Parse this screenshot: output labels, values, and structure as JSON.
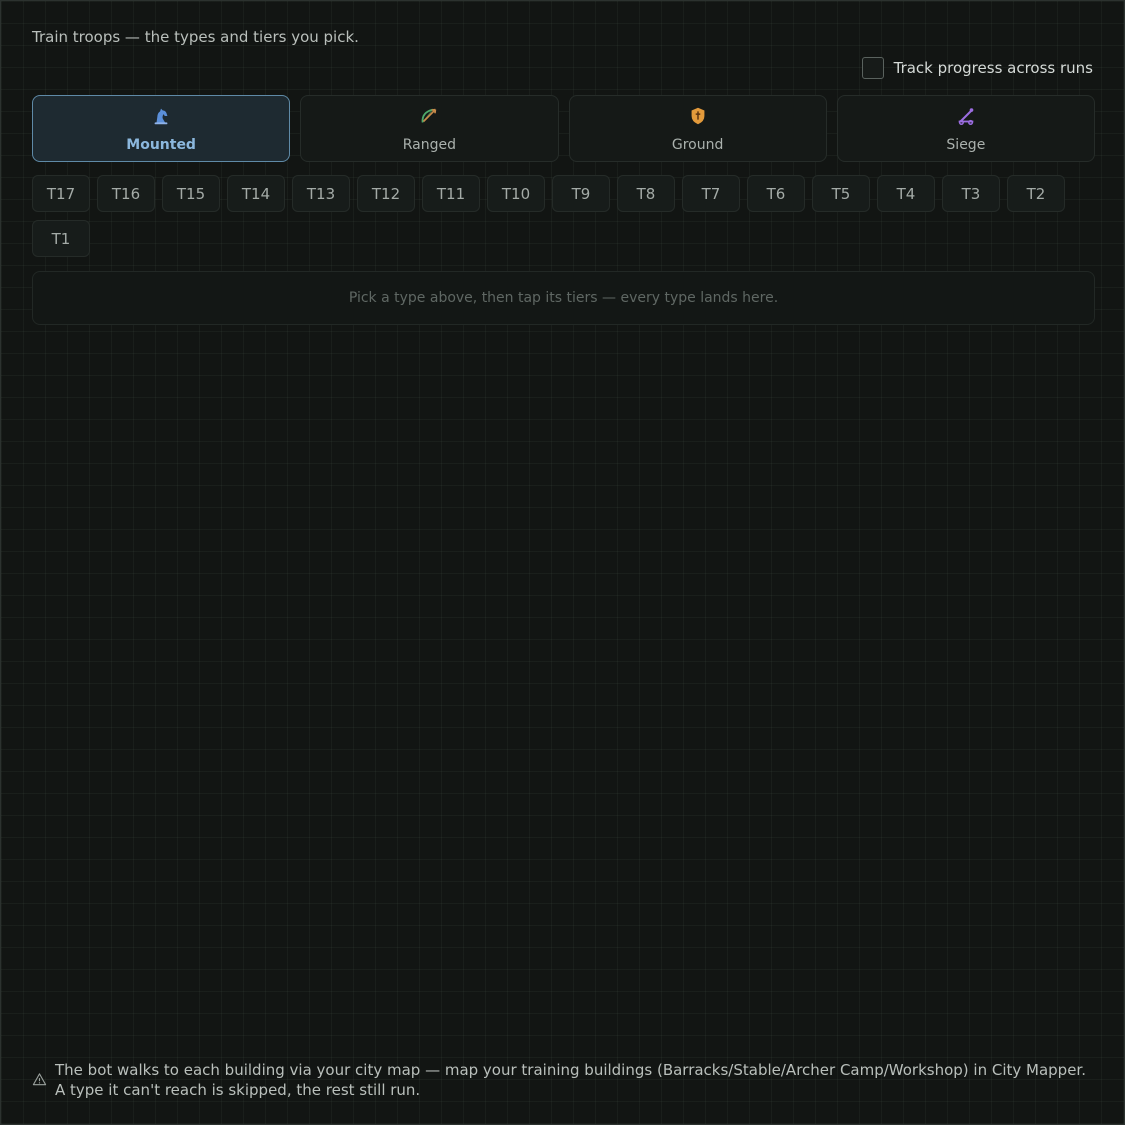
{
  "intro": "Train troops — the types and tiers you pick.",
  "track_progress": {
    "label": "Track progress across runs",
    "checked": false
  },
  "types": [
    {
      "label": "Mounted",
      "icon": "horse-icon",
      "color": "#5b8fd9",
      "selected": true
    },
    {
      "label": "Ranged",
      "icon": "bow-arrow-icon",
      "color": "#4ea86a",
      "selected": false
    },
    {
      "label": "Ground",
      "icon": "shield-icon",
      "color": "#e39a3b",
      "selected": false
    },
    {
      "label": "Siege",
      "icon": "catapult-icon",
      "color": "#9b6de0",
      "selected": false
    }
  ],
  "tiers": [
    "T17",
    "T16",
    "T15",
    "T14",
    "T13",
    "T12",
    "T11",
    "T10",
    "T9",
    "T8",
    "T7",
    "T6",
    "T5",
    "T4",
    "T3",
    "T2",
    "T1"
  ],
  "dropzone_hint": "Pick a type above, then tap its tiers — every type lands here.",
  "footer_note": "The bot walks to each building via your city map — map your training buildings (Barracks/Stable/Archer Camp/Workshop) in City Mapper. A type it can't reach is skipped, the rest still run."
}
